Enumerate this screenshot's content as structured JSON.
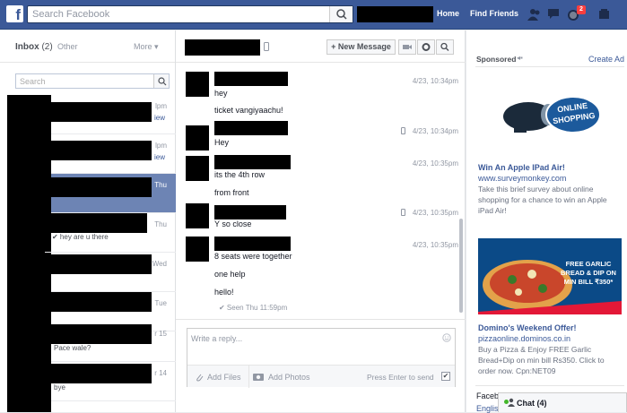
{
  "topbar": {
    "logo": "f",
    "search_placeholder": "Search Facebook",
    "nav_home": "Home",
    "nav_find_friends": "Find Friends",
    "notification_count": "2"
  },
  "inbox": {
    "title": "Inbox",
    "count": "(2)",
    "other_tab": "Other",
    "more_tab": "More ▾",
    "search_placeholder": "Search",
    "conversations": [
      {
        "time": "lpm",
        "snippet": "",
        "tag": "iew"
      },
      {
        "time": "lpm",
        "snippet": "",
        "tag": "iew"
      },
      {
        "time": "Thu",
        "snippet": "",
        "tag": ""
      },
      {
        "time": "Thu",
        "snippet": "✔ hey are u there",
        "tag": ""
      },
      {
        "time": "Wed",
        "snippet": "",
        "tag": ""
      },
      {
        "time": "Tue",
        "snippet": "",
        "tag": ""
      },
      {
        "time": "r 15",
        "snippet": "Pace wale?",
        "tag": ""
      },
      {
        "time": "r 14",
        "snippet": "bye",
        "tag": ""
      }
    ]
  },
  "thread": {
    "new_message_label": "+ New Message",
    "messages": [
      {
        "text": "hey",
        "time": "4/23, 10:34pm"
      },
      {
        "text": "ticket vangiyaachu!",
        "time": ""
      },
      {
        "text": "Hey",
        "time": "4/23, 10:34pm"
      },
      {
        "text": "its the 4th row",
        "time": "4/23, 10:35pm"
      },
      {
        "text": "from front",
        "time": ""
      },
      {
        "text": "Y so close",
        "time": "4/23, 10:35pm"
      },
      {
        "text": "8 seats were together",
        "time": "4/23, 10:35pm"
      },
      {
        "text": "one help",
        "time": ""
      },
      {
        "text": "hello!",
        "time": ""
      }
    ],
    "seen": "✔ Seen Thu 11:59pm",
    "reply_placeholder": "Write a reply...",
    "add_files": "Add Files",
    "add_photos": "Add Photos",
    "press_enter": "Press Enter to send"
  },
  "ads": {
    "sponsored": "Sponsored",
    "create_ad": "Create Ad",
    "ad1": {
      "image_text": "ONLINE SHOPPING",
      "title": "Win An Apple IPad Air!",
      "url": "www.surveymonkey.com",
      "body": "Take this brief survey about online shopping for a chance to win an Apple iPad Air!"
    },
    "ad2": {
      "image_text": "FREE GARLIC BREAD & DIP ON MIN BILL ₹350*",
      "title": "Domino's Weekend Offer!",
      "url": "pizzaonline.dominos.co.in",
      "body": "Buy a Pizza & Enjoy FREE Garlic Bread+Dip on min bill Rs350. Click to order now. Cpn:NET09"
    },
    "footer_partial_1": "Faceb",
    "footer_partial_2": "Englis"
  },
  "chat": {
    "label": "Chat (4)"
  },
  "colors": {
    "brand": "#3b5998",
    "selected_row": "#6d84b4"
  }
}
